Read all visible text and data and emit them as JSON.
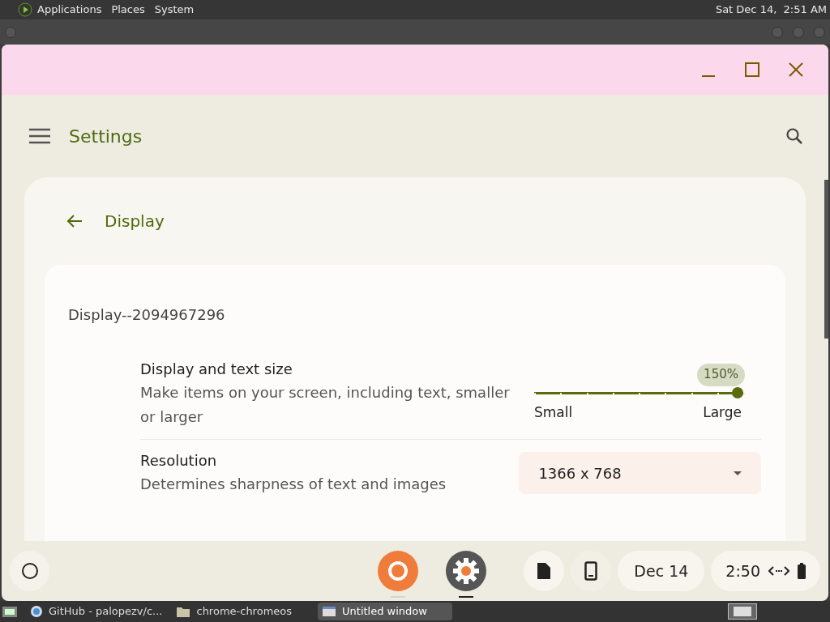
{
  "top_panel": {
    "menus": [
      "Applications",
      "Places",
      "System"
    ],
    "clock": "Sat Dec 14,  2:51 AM"
  },
  "app": {
    "title": "Settings",
    "page_title": "Display",
    "display_name": "Display--2094967296",
    "settings": [
      {
        "kind": "slider",
        "label": "Display and text size",
        "description": "Make items on your screen, including text, smaller or larger",
        "bubble": "150%",
        "level": 1,
        "min_label": "Small",
        "max_label": "Large"
      },
      {
        "kind": "dropdown",
        "label": "Resolution",
        "description": "Determines sharpness of text and images",
        "value": "1366 x 768"
      }
    ]
  },
  "shelf": {
    "apps": [
      {
        "kind": "browser",
        "active": false
      },
      {
        "kind": "settings",
        "active": true
      }
    ],
    "date": "Dec 14",
    "time": "2:50"
  },
  "taskbar": {
    "items": [
      {
        "label": "GitHub - palopezv/c...",
        "kind": "browser",
        "selected": false
      },
      {
        "label": "chrome-chromeos",
        "kind": "folder",
        "selected": false
      },
      {
        "label": "Untitled window",
        "kind": "window",
        "selected": true
      }
    ]
  }
}
